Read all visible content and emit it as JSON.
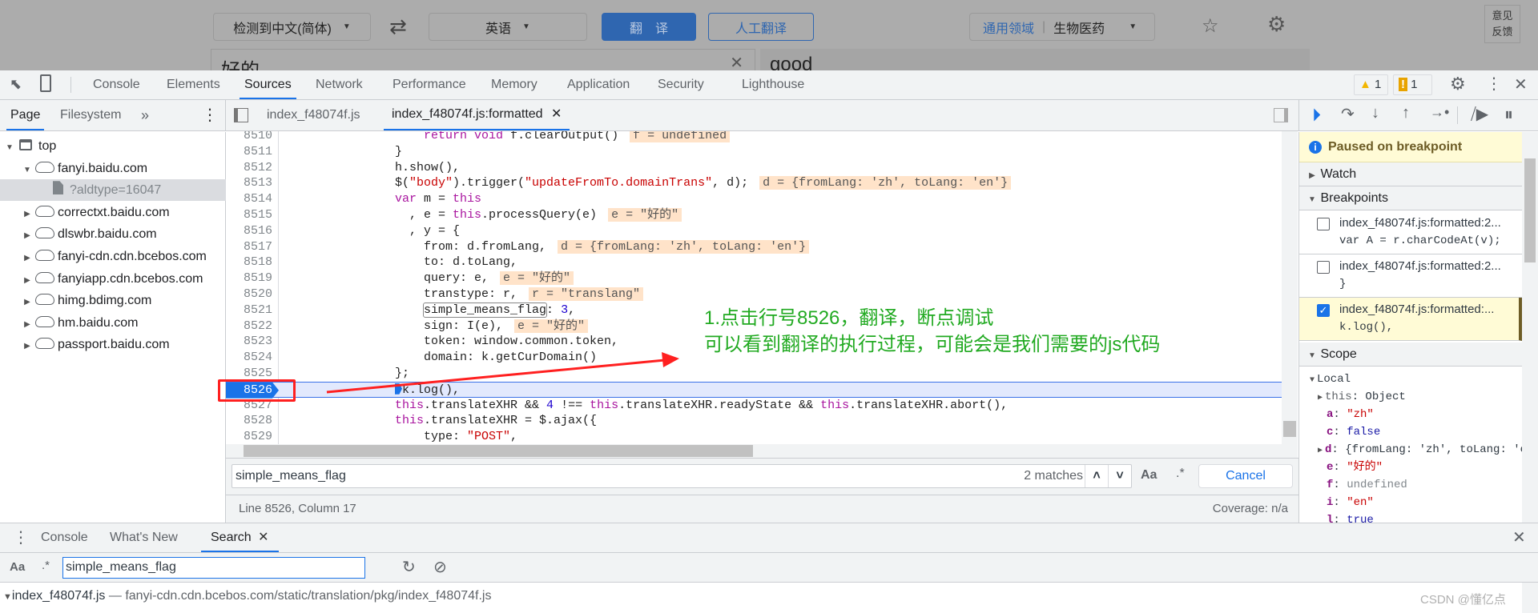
{
  "page": {
    "source_lang": "检测到中文(简体)",
    "swap_icon": "swap-arrows",
    "target_lang": "英语",
    "translate_button": "翻　译",
    "human_translate_button": "人工翻译",
    "domain_general": "通用领域",
    "domain_selected": "生物医药",
    "feedback_button": "意见\n反馈",
    "input_text": "好的",
    "output_text": "good"
  },
  "devtools": {
    "tabs": [
      "Console",
      "Elements",
      "Sources",
      "Network",
      "Performance",
      "Memory",
      "Application",
      "Security",
      "Lighthouse"
    ],
    "active_tab": "Sources",
    "warnings_count": "1",
    "issues_count": "1",
    "navigator_tabs": [
      "Page",
      "Filesystem"
    ],
    "more_tabs": "»",
    "file_tabs": [
      "index_f48074f.js",
      "index_f48074f.js:formatted"
    ],
    "active_file_tab": "index_f48074f.js:formatted",
    "tree": [
      {
        "label": "top",
        "level": 0,
        "expanded": true,
        "icon": "frame"
      },
      {
        "label": "fanyi.baidu.com",
        "level": 1,
        "expanded": true,
        "icon": "cloud"
      },
      {
        "label": "?aldtype=16047",
        "level": 2,
        "icon": "file",
        "selected": true
      },
      {
        "label": "correctxt.baidu.com",
        "level": 1,
        "expanded": false,
        "icon": "cloud"
      },
      {
        "label": "dlswbr.baidu.com",
        "level": 1,
        "expanded": false,
        "icon": "cloud"
      },
      {
        "label": "fanyi-cdn.cdn.bcebos.com",
        "level": 1,
        "expanded": false,
        "icon": "cloud"
      },
      {
        "label": "fanyiapp.cdn.bcebos.com",
        "level": 1,
        "expanded": false,
        "icon": "cloud"
      },
      {
        "label": "himg.bdimg.com",
        "level": 1,
        "expanded": false,
        "icon": "cloud"
      },
      {
        "label": "hm.baidu.com",
        "level": 1,
        "expanded": false,
        "icon": "cloud"
      },
      {
        "label": "passport.baidu.com",
        "level": 1,
        "expanded": false,
        "icon": "cloud"
      }
    ],
    "code": [
      {
        "n": "8510",
        "t": [
          [
            "    ",
            ""
          ],
          [
            "return",
            "kw"
          ],
          [
            " ",
            ""
          ],
          [
            "void",
            "kw"
          ],
          [
            " f.clearOutput()",
            ""
          ]
        ],
        "anno": "f = undefined"
      },
      {
        "n": "8511",
        "t": [
          [
            "}",
            ""
          ]
        ]
      },
      {
        "n": "8512",
        "t": [
          [
            "h.show(),",
            ""
          ]
        ]
      },
      {
        "n": "8513",
        "t": [
          [
            "$(",
            ""
          ],
          [
            "\"body\"",
            "str"
          ],
          [
            ").trigger(",
            ""
          ],
          [
            "\"updateFromTo.domainTrans\"",
            "str"
          ],
          [
            ", d);",
            ""
          ]
        ],
        "anno": "d = {fromLang: 'zh', toLang: 'en'}"
      },
      {
        "n": "8514",
        "t": [
          [
            "var",
            "kw"
          ],
          [
            " m = ",
            ""
          ],
          [
            "this",
            "kw"
          ]
        ]
      },
      {
        "n": "8515",
        "t": [
          [
            "  , e = ",
            ""
          ],
          [
            "this",
            "kw"
          ],
          [
            ".processQuery(e)",
            ""
          ]
        ],
        "anno": "e = \"好的\""
      },
      {
        "n": "8516",
        "t": [
          [
            "  , y = {",
            ""
          ]
        ]
      },
      {
        "n": "8517",
        "t": [
          [
            "    from: d.fromLang,",
            ""
          ]
        ],
        "anno": "d = {fromLang: 'zh', toLang: 'en'}"
      },
      {
        "n": "8518",
        "t": [
          [
            "    to: d.toLang,",
            ""
          ]
        ]
      },
      {
        "n": "8519",
        "t": [
          [
            "    query: e,",
            ""
          ]
        ],
        "anno": "e = \"好的\""
      },
      {
        "n": "8520",
        "t": [
          [
            "    transtype: r,",
            ""
          ]
        ],
        "anno": "r = \"translang\""
      },
      {
        "n": "8521",
        "t": [
          [
            "    ",
            ""
          ],
          [
            "simple_means_flag",
            "match"
          ],
          [
            ": ",
            ""
          ],
          [
            "3",
            "num"
          ],
          [
            ",",
            ""
          ]
        ]
      },
      {
        "n": "8522",
        "t": [
          [
            "    sign: I(e),",
            ""
          ]
        ],
        "anno": "e = \"好的\""
      },
      {
        "n": "8523",
        "t": [
          [
            "    token: window.common.token,",
            ""
          ]
        ]
      },
      {
        "n": "8524",
        "t": [
          [
            "    domain: k.getCurDomain()",
            ""
          ]
        ]
      },
      {
        "n": "8525",
        "t": [
          [
            "};",
            ""
          ]
        ]
      },
      {
        "n": "8526",
        "t": [
          [
            "k.log(),",
            ""
          ]
        ],
        "current": true
      },
      {
        "n": "8527",
        "t": [
          [
            "this",
            "kw"
          ],
          [
            ".translateXHR && ",
            ""
          ],
          [
            "4",
            "num"
          ],
          [
            " !== ",
            ""
          ],
          [
            "this",
            "kw"
          ],
          [
            ".translateXHR.readyState && ",
            ""
          ],
          [
            "this",
            "kw"
          ],
          [
            ".translateXHR.abort(),",
            ""
          ]
        ]
      },
      {
        "n": "8528",
        "t": [
          [
            "this",
            "kw"
          ],
          [
            ".translateXHR = $.ajax({",
            ""
          ]
        ]
      },
      {
        "n": "8529",
        "t": [
          [
            "    type: ",
            ""
          ],
          [
            "\"POST\"",
            "str"
          ],
          [
            ",",
            ""
          ]
        ]
      }
    ],
    "annotation_note": [
      "1.点击行号8526，翻译，断点调试",
      "可以看到翻译的执行过程，可能会是我们需要的js代码"
    ],
    "find": {
      "value": "simple_means_flag",
      "matches": "2 matches",
      "case_label": "Aa",
      "regex_label": ".*",
      "cancel": "Cancel"
    },
    "status": {
      "position": "Line 8526, Column 17",
      "coverage": "Coverage: n/a"
    },
    "debugger": {
      "paused": "Paused on breakpoint",
      "watch": "Watch",
      "breakpoints_header": "Breakpoints",
      "breakpoints": [
        {
          "file": "index_f48074f.js:formatted:2...",
          "code": "var A = r.charCodeAt(v);",
          "checked": false
        },
        {
          "file": "index_f48074f.js:formatted:2...",
          "code": "}",
          "checked": false
        },
        {
          "file": "index_f48074f.js:formatted:...",
          "code": "k.log(),",
          "checked": true
        }
      ],
      "scope_header": "Scope",
      "local": "Local",
      "scope": [
        {
          "k": "this",
          "v": "Object",
          "type": "obj",
          "expandable": true
        },
        {
          "k": "a",
          "v": "\"zh\"",
          "type": "str"
        },
        {
          "k": "c",
          "v": "false",
          "type": "bool"
        },
        {
          "k": "d",
          "v": "{fromLang: 'zh', toLang: 'en'}",
          "type": "obj",
          "expandable": true
        },
        {
          "k": "e",
          "v": "\"好的\"",
          "type": "str"
        },
        {
          "k": "f",
          "v": "undefined",
          "type": "undef"
        },
        {
          "k": "i",
          "v": "\"en\"",
          "type": "str"
        },
        {
          "k": "l",
          "v": "true",
          "type": "bool"
        }
      ]
    },
    "drawer": {
      "tabs": [
        "Console",
        "What's New",
        "Search"
      ],
      "active": "Search",
      "case_label": "Aa",
      "regex_label": ".*",
      "query": "simple_means_flag",
      "result_file": "index_f48074f.js",
      "result_url": "— fanyi-cdn.cdn.bcebos.com/static/translation/pkg/index_f48074f.js"
    }
  },
  "watermark": "CSDN @懂亿点",
  "colors": {
    "accent": "#1a73e8",
    "annotation_red": "#ff2020",
    "annotation_green": "#22aa22",
    "paused_bg": "#fffbd6"
  }
}
